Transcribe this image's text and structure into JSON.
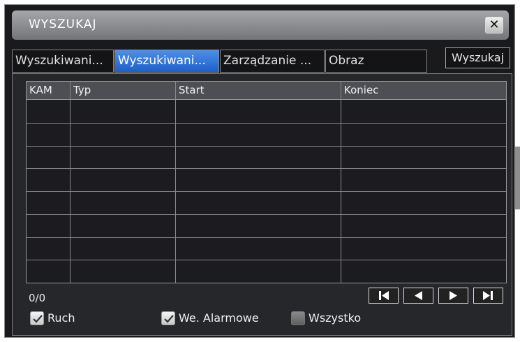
{
  "window": {
    "title": "WYSZUKAJ",
    "close_symbol": "✕"
  },
  "tabs": [
    {
      "label": "Wyszukiwani...",
      "active": false
    },
    {
      "label": "Wyszukiwani...",
      "active": true
    },
    {
      "label": "Zarządzanie ...",
      "active": false
    },
    {
      "label": "Obraz",
      "active": false
    }
  ],
  "search_button": "Wyszukaj",
  "table": {
    "columns": [
      "KAM",
      "Typ",
      "Start",
      "Koniec"
    ],
    "rows": [
      [
        "",
        "",
        "",
        ""
      ],
      [
        "",
        "",
        "",
        ""
      ],
      [
        "",
        "",
        "",
        ""
      ],
      [
        "",
        "",
        "",
        ""
      ],
      [
        "",
        "",
        "",
        ""
      ],
      [
        "",
        "",
        "",
        ""
      ],
      [
        "",
        "",
        "",
        ""
      ],
      [
        "",
        "",
        "",
        ""
      ]
    ]
  },
  "pagination": {
    "count": "0/0",
    "buttons": [
      "first-page-icon",
      "prev-page-icon",
      "next-page-icon",
      "last-page-icon"
    ]
  },
  "filters": [
    {
      "label": "Ruch",
      "checked": true
    },
    {
      "label": "We. Alarmowe",
      "checked": true
    },
    {
      "label": "Wszystko",
      "checked": false
    }
  ],
  "colors": {
    "active_tab": "#2f72dc",
    "background": "#1a1a1d",
    "title_bar": "#8c8e91"
  }
}
